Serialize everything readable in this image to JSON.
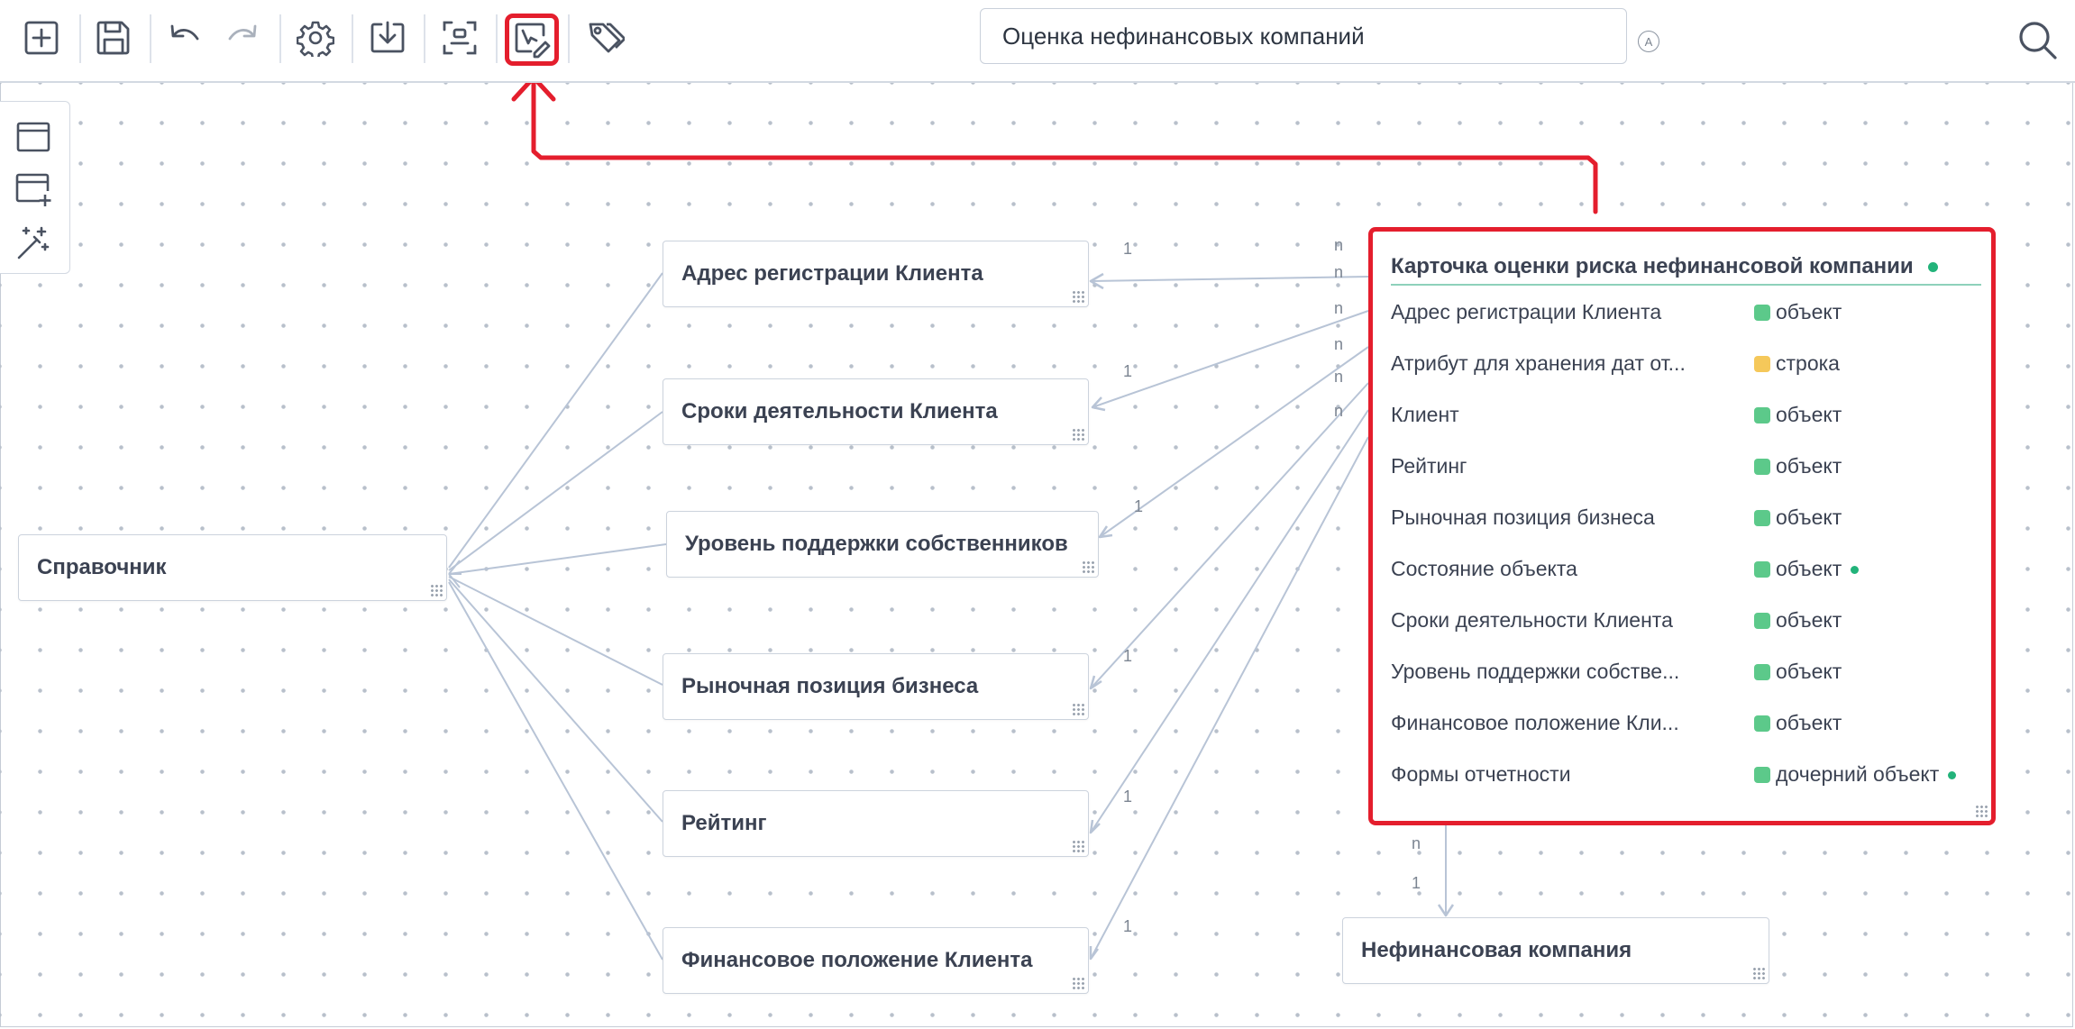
{
  "toolbar": {
    "buttons": [
      {
        "icon": "add-square-icon"
      },
      {
        "icon": "save-icon"
      },
      {
        "icon": "undo-icon"
      },
      {
        "icon": "redo-icon"
      },
      {
        "icon": "settings-gear-icon"
      },
      {
        "icon": "download-icon"
      },
      {
        "icon": "scan-focus-icon"
      },
      {
        "icon": "edit-select-icon",
        "highlighted": true
      },
      {
        "icon": "tags-icon"
      }
    ],
    "title_value": "Оценка нефинансовых компаний",
    "auto_badge": "A",
    "search_icon": "search-icon"
  },
  "left_panel": {
    "buttons": [
      {
        "icon": "window-icon"
      },
      {
        "icon": "window-add-icon"
      },
      {
        "icon": "magic-wand-icon"
      }
    ]
  },
  "colors": {
    "highlight": "#e41e2d",
    "edge": "#b8c4d6",
    "object_type": "#5cc98a",
    "string_type": "#f5c85a",
    "status_dot": "#22b37a"
  },
  "nodes": {
    "reference": "Справочник",
    "address": "Адрес регистрации Клиента",
    "terms": "Сроки деятельности Клиента",
    "support": "Уровень поддержки собственников",
    "market": "Рыночная позиция бизнеса",
    "rating": "Рейтинг",
    "financial": "Финансовое положение Клиента",
    "nonfin": "Нефинансовая компания"
  },
  "card": {
    "title": "Карточка оценки риска нефинансовой компании",
    "attributes": [
      {
        "name": "Адрес регистрации Клиента",
        "type": "объект",
        "kind": "object",
        "status": false
      },
      {
        "name": "Атрибут для хранения дат от...",
        "type": "строка",
        "kind": "string",
        "status": false
      },
      {
        "name": "Клиент",
        "type": "объект",
        "kind": "object",
        "status": false
      },
      {
        "name": "Рейтинг",
        "type": "объект",
        "kind": "object",
        "status": false
      },
      {
        "name": "Рыночная позиция бизнеса",
        "type": "объект",
        "kind": "object",
        "status": false
      },
      {
        "name": "Состояние объекта",
        "type": "объект",
        "kind": "object",
        "status": true
      },
      {
        "name": "Сроки деятельности Клиента",
        "type": "объект",
        "kind": "object",
        "status": false
      },
      {
        "name": "Уровень поддержки собстве...",
        "type": "объект",
        "kind": "object",
        "status": false
      },
      {
        "name": "Финансовое положение Кли...",
        "type": "объект",
        "kind": "object",
        "status": false
      },
      {
        "name": "Формы отчетности",
        "type": "дочерний объект",
        "kind": "object",
        "status": true
      }
    ]
  },
  "cardinality": {
    "one": "1",
    "many": "n"
  }
}
